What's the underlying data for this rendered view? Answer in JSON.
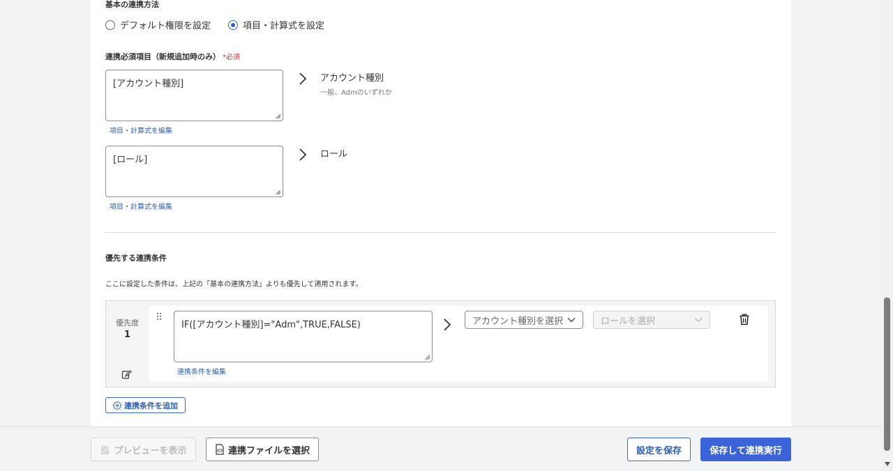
{
  "basic_method": {
    "heading": "基本の連携方法",
    "options": [
      {
        "label": "デフォルト権限を設定",
        "selected": false
      },
      {
        "label": "項目・計算式を設定",
        "selected": true
      }
    ]
  },
  "required_fields": {
    "heading": "連携必須項目（新規追加時のみ）",
    "required_mark": "*",
    "required_label": "必須",
    "rows": [
      {
        "formula": "[アカウント種別]",
        "edit_link": "項目・計算式を編集",
        "target": "アカウント種別",
        "target_sub": "一般、Admのいずれか"
      },
      {
        "formula": "[ロール]",
        "edit_link": "項目・計算式を編集",
        "target": "ロール",
        "target_sub": ""
      }
    ]
  },
  "priority": {
    "heading": "優先する連携条件",
    "description": "ここに設定した条件は、上記の「基本の連携方法」よりも優先して適用されます。",
    "conditions": [
      {
        "priority_label": "優先度",
        "priority_value": "1",
        "formula": "IF([アカウント種別]=\"Adm\",TRUE,FALSE)",
        "edit_link": "連携条件を編集",
        "account_select_placeholder": "アカウント種別を選択",
        "role_select_placeholder": "ロールを選択"
      }
    ],
    "add_button": "連携条件を追加"
  },
  "footer": {
    "preview_button": "プレビューを表示",
    "select_file_button": "連携ファイルを選択",
    "save_button": "設定を保存",
    "save_run_button": "保存して連携実行"
  },
  "colors": {
    "accent": "#2f5fd0",
    "primary_button": "#3a64d8",
    "required": "#d0302f",
    "link": "#2f5fb3"
  },
  "icons": [
    "chevron-right-icon",
    "drag-handle-icon",
    "edit-icon",
    "trash-icon",
    "plus-circle-icon",
    "preview-icon",
    "csv-file-icon",
    "chevron-down-icon",
    "scroll-down-icon"
  ]
}
